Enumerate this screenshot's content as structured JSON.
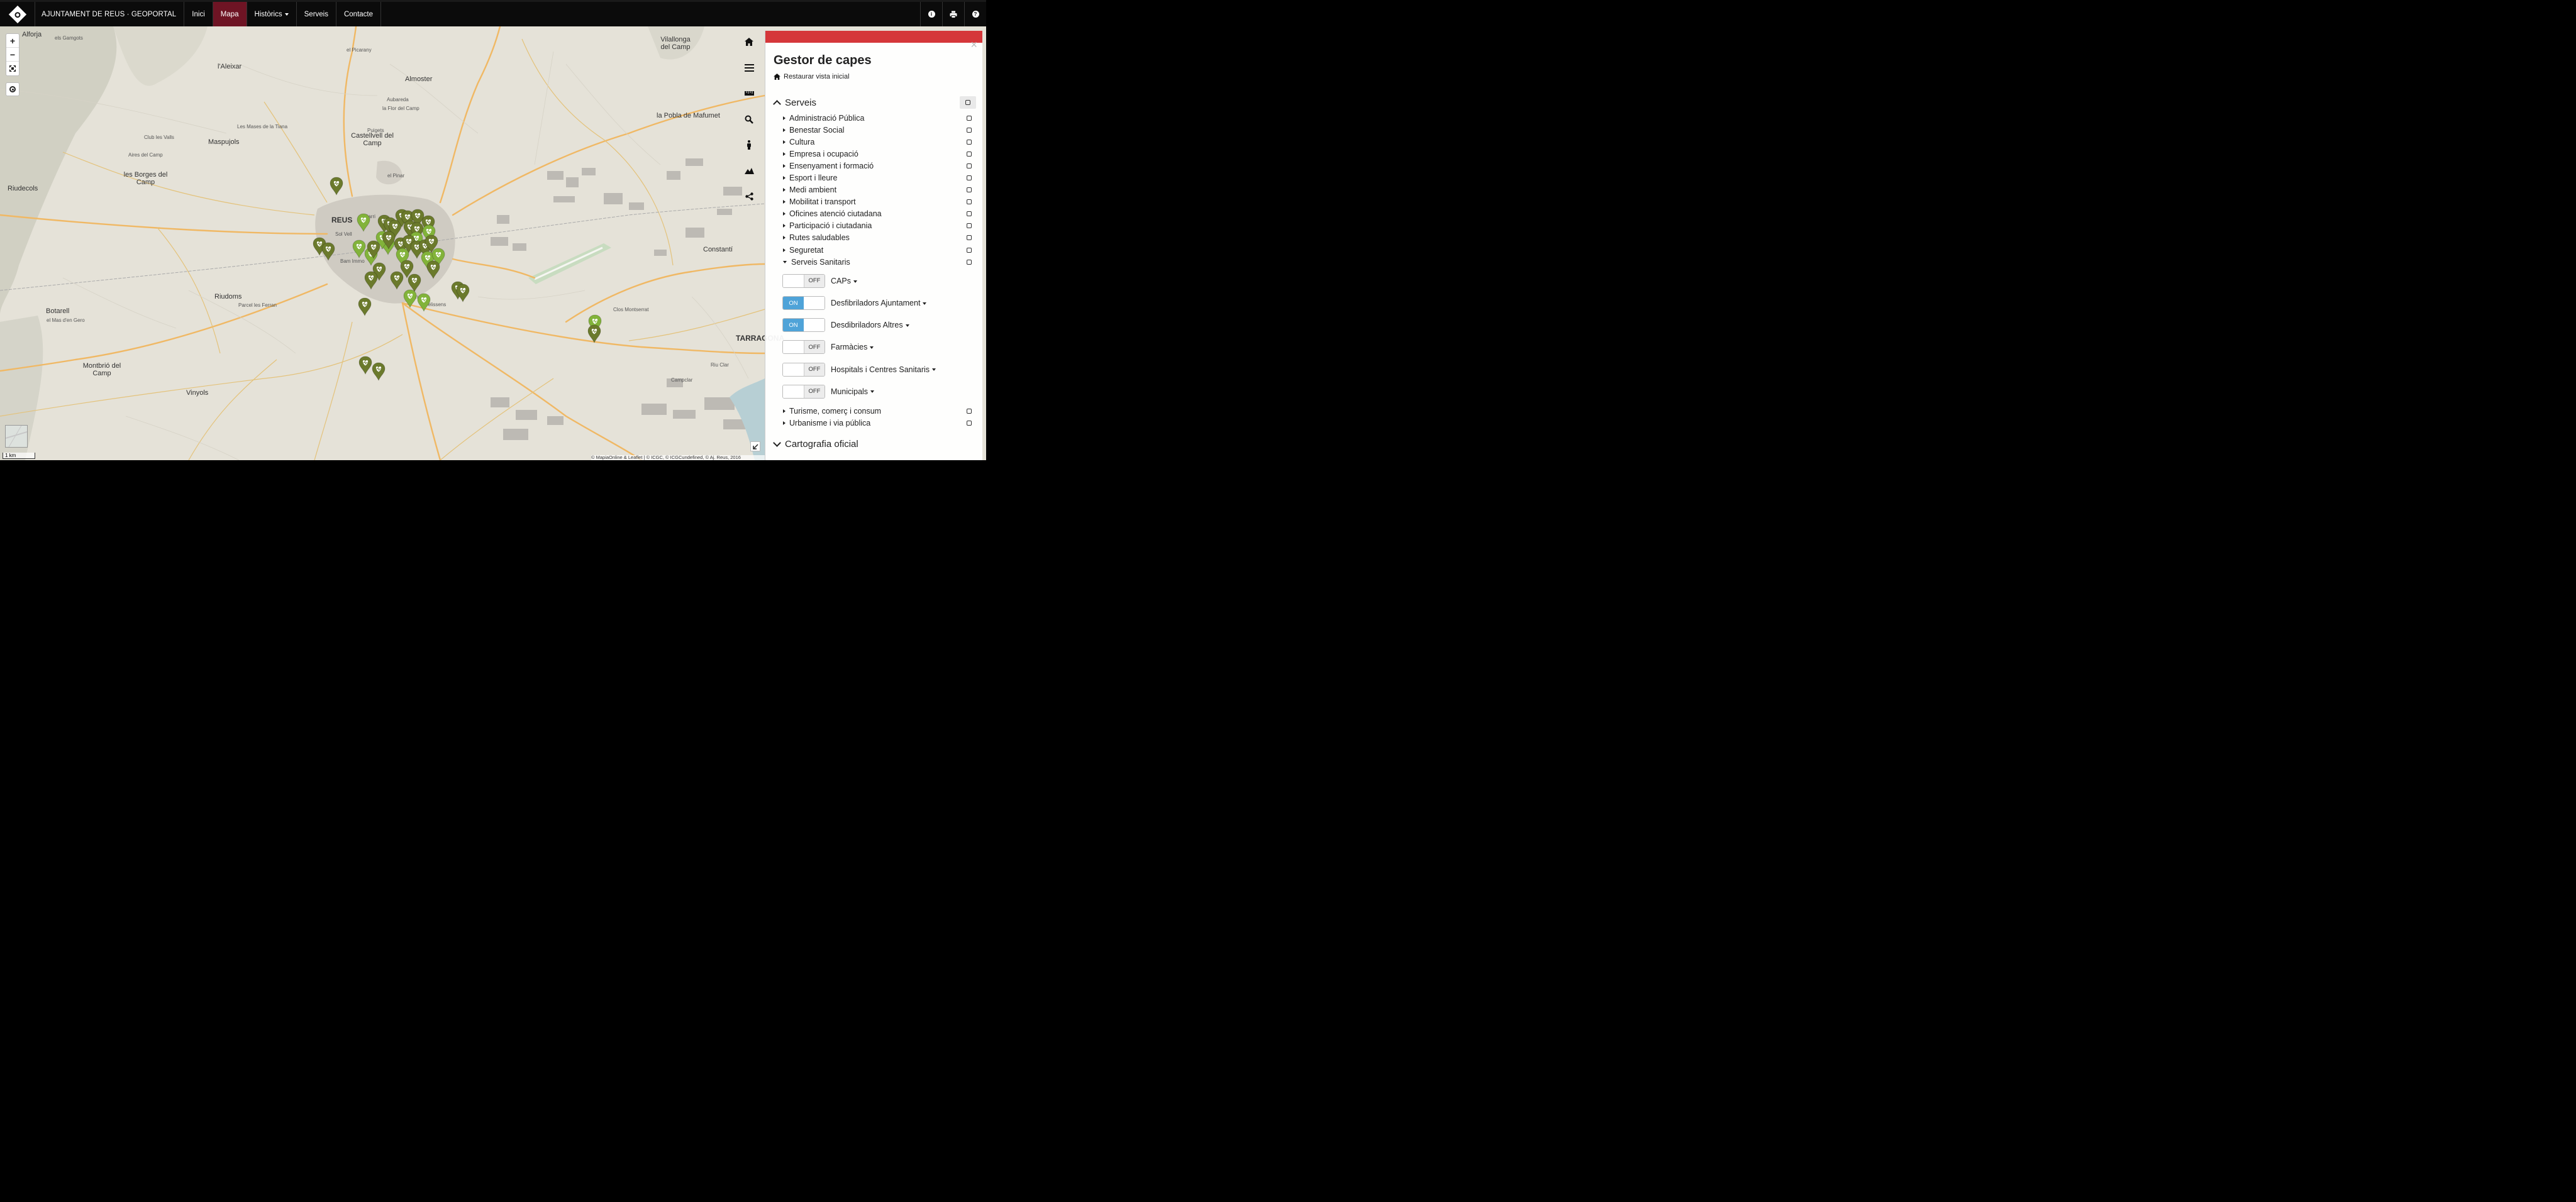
{
  "navbar": {
    "brand_title": "AJUNTAMENT DE REUS · GEOPORTAL",
    "items": [
      {
        "label": "Inici",
        "active": false
      },
      {
        "label": "Mapa",
        "active": true
      },
      {
        "label": "Històrics",
        "active": false,
        "dropdown": true
      },
      {
        "label": "Serveis",
        "active": false
      },
      {
        "label": "Contacte",
        "active": false
      }
    ],
    "right_icons": [
      "info-icon",
      "print-icon",
      "help-icon"
    ]
  },
  "map": {
    "zoom_in": "+",
    "zoom_out": "−",
    "scale_label": "1 km",
    "attribution": "© MapiaOnline & Leaflet | © ICGC, © ICGCundefined, © Aj. Reus, 2016",
    "places": [
      {
        "name": "Alforja",
        "cls": ""
      },
      {
        "name": "els Gamgots",
        "cls": "small"
      },
      {
        "name": "l'Aleixar",
        "cls": ""
      },
      {
        "name": "el Picarany",
        "cls": "small"
      },
      {
        "name": "Almoster",
        "cls": ""
      },
      {
        "name": "Vilallonga del Camp",
        "cls": ""
      },
      {
        "name": "Aubareda",
        "cls": "small"
      },
      {
        "name": "la Flor del Camp",
        "cls": "small"
      },
      {
        "name": "Les Mases de la Tiana",
        "cls": "small"
      },
      {
        "name": "Puigets",
        "cls": "small"
      },
      {
        "name": "Castellvell del Camp",
        "cls": ""
      },
      {
        "name": "la Pobla de Mafumet",
        "cls": ""
      },
      {
        "name": "Maspujols",
        "cls": ""
      },
      {
        "name": "Club les Valls",
        "cls": "small"
      },
      {
        "name": "Aires del Camp",
        "cls": "small"
      },
      {
        "name": "les Borges del Camp",
        "cls": ""
      },
      {
        "name": "Riudecols",
        "cls": ""
      },
      {
        "name": "el Pinar",
        "cls": "small"
      },
      {
        "name": "REUS",
        "cls": "big"
      },
      {
        "name": "Barri",
        "cls": "small"
      },
      {
        "name": "Sol Vell",
        "cls": "small"
      },
      {
        "name": "Bam Immo",
        "cls": "small"
      },
      {
        "name": "Constantí",
        "cls": ""
      },
      {
        "name": "Riudoms",
        "cls": ""
      },
      {
        "name": "Parcel les Ferran",
        "cls": "small"
      },
      {
        "name": "Botarell",
        "cls": ""
      },
      {
        "name": "el Mas d'en Gero",
        "cls": "small"
      },
      {
        "name": "Juncosa",
        "cls": "small"
      },
      {
        "name": "Belissens",
        "cls": "small"
      },
      {
        "name": "Clos Montserrat",
        "cls": "small"
      },
      {
        "name": "TARRAGONA",
        "cls": "big"
      },
      {
        "name": "Montbrió del Camp",
        "cls": ""
      },
      {
        "name": "Vinyols",
        "cls": ""
      },
      {
        "name": "Campclar",
        "cls": "small"
      },
      {
        "name": "Riu Clar",
        "cls": "small"
      }
    ],
    "markers_count": 44
  },
  "side_tools": [
    "home-icon",
    "menu-icon",
    "ruler-icon",
    "search-icon",
    "street-view-icon",
    "terrain-icon",
    "share-icon"
  ],
  "layer_panel": {
    "title": "Gestor de capes",
    "restore_label": "Restaurar vista inicial",
    "section_serveis": "Serveis",
    "categories": [
      "Administració Pública",
      "Benestar Social",
      "Cultura",
      "Empresa i ocupació",
      "Ensenyament i formació",
      "Esport i lleure",
      "Medi ambient",
      "Mobilitat i transport",
      "Oficines atenció ciutadana",
      "Participació i ciutadania",
      "Rutes saludables",
      "Seguretat"
    ],
    "expanded_category": "Serveis Sanitaris",
    "sublayers": [
      {
        "label": "CAPs",
        "state": "OFF"
      },
      {
        "label": "Desfibriladors Ajuntament",
        "state": "ON"
      },
      {
        "label": "Desdibriladors Altres",
        "state": "ON"
      },
      {
        "label": "Farmàcies",
        "state": "OFF"
      },
      {
        "label": "Hospitals i Centres Sanitaris",
        "state": "OFF"
      },
      {
        "label": "Municipals",
        "state": "OFF"
      }
    ],
    "categories_after": [
      "Turisme, comerç i consum",
      "Urbanisme i via pública"
    ],
    "section_cartografia": "Cartografia oficial"
  },
  "colors": {
    "nav_bg": "#0b0b0b",
    "nav_active": "#6e1424",
    "panel_accent": "#d5373a",
    "toggle_on": "#4fa3d8",
    "marker_dark": "#6b7a2c",
    "marker_light": "#82b33a"
  }
}
